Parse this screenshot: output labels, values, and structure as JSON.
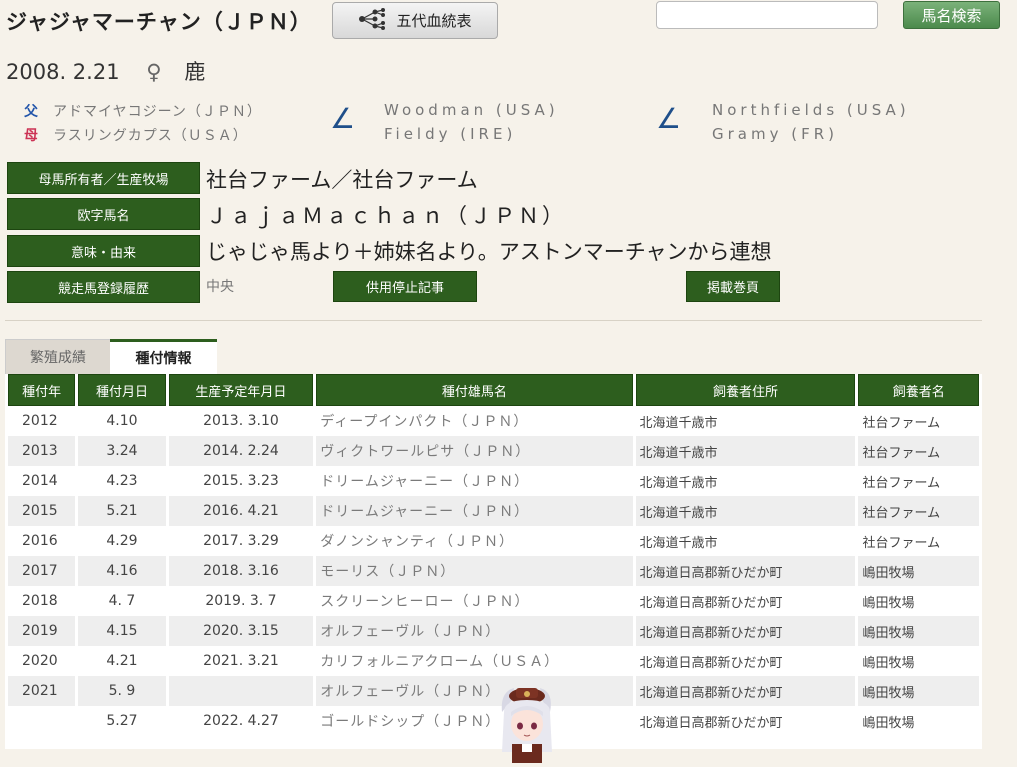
{
  "header": {
    "horse_name": "ジャジャマーチャン（ＪＰＮ）",
    "pedigree_button": "五代血統表",
    "search_placeholder": "",
    "search_button": "馬名検索"
  },
  "birth": {
    "date": "2008. 2.21",
    "sex": "♀",
    "color": "鹿"
  },
  "pedigree": {
    "father_symbol": "父",
    "father": "アドマイヤコジーン（ＪＰＮ）",
    "mother_symbol": "母",
    "mother": "ラスリングカプス（ＵＳＡ）",
    "angle_glyph": "∠",
    "fathers_sire": "Woodman (USA)",
    "fathers_dam": "Fieldy (IRE)",
    "mothers_sire": "Northfields (USA)",
    "mothers_dam": "Gramy (FR)"
  },
  "info": {
    "owner_label": "母馬所有者／生産牧場",
    "owner_value": "社台ファーム／社台ファーム",
    "roman_label": "欧字馬名",
    "roman_value": "ＪａｊａＭａｃｈａｎ（ＪＰＮ）",
    "meaning_label": "意味・由来",
    "meaning_value": "じゃじゃ馬より＋姉妹名より。アストンマーチャンから連想",
    "registration_label": "競走馬登録履歴",
    "registration_value": "中央",
    "retire_button": "供用停止記事",
    "volume_button": "掲載巻頁"
  },
  "tabs": {
    "breeding": "繁殖成績",
    "mating": "種付情報"
  },
  "table": {
    "headers": [
      "種付年",
      "種付月日",
      "生産予定年月日",
      "種付雄馬名",
      "飼養者住所",
      "飼養者名"
    ],
    "rows": [
      [
        "2012",
        "4.10",
        "2013. 3.10",
        "ディープインパクト（ＪＰＮ）",
        "北海道千歳市",
        "社台ファーム"
      ],
      [
        "2013",
        "3.24",
        "2014. 2.24",
        "ヴィクトワールピサ（ＪＰＮ）",
        "北海道千歳市",
        "社台ファーム"
      ],
      [
        "2014",
        "4.23",
        "2015. 3.23",
        "ドリームジャーニー（ＪＰＮ）",
        "北海道千歳市",
        "社台ファーム"
      ],
      [
        "2015",
        "5.21",
        "2016. 4.21",
        "ドリームジャーニー（ＪＰＮ）",
        "北海道千歳市",
        "社台ファーム"
      ],
      [
        "2016",
        "4.29",
        "2017. 3.29",
        "ダノンシャンティ（ＪＰＮ）",
        "北海道千歳市",
        "社台ファーム"
      ],
      [
        "2017",
        "4.16",
        "2018. 3.16",
        "モーリス（ＪＰＮ）",
        "北海道日高郡新ひだか町",
        "嶋田牧場"
      ],
      [
        "2018",
        "4. 7",
        "2019. 3. 7",
        "スクリーンヒーロー（ＪＰＮ）",
        "北海道日高郡新ひだか町",
        "嶋田牧場"
      ],
      [
        "2019",
        "4.15",
        "2020. 3.15",
        "オルフェーヴル（ＪＰＮ）",
        "北海道日高郡新ひだか町",
        "嶋田牧場"
      ],
      [
        "2020",
        "4.21",
        "2021. 3.21",
        "カリフォルニアクローム（ＵＳＡ）",
        "北海道日高郡新ひだか町",
        "嶋田牧場"
      ],
      [
        "2021",
        "5. 9",
        "",
        "オルフェーヴル（ＪＰＮ）",
        "北海道日高郡新ひだか町",
        "嶋田牧場"
      ],
      [
        "",
        "5.27",
        "2022. 4.27",
        "ゴールドシップ（ＪＰＮ）",
        "北海道日高郡新ひだか町",
        "嶋田牧場"
      ]
    ]
  },
  "colors": {
    "accent_green": "#2d5e1e",
    "background": "#f6f2ea"
  }
}
